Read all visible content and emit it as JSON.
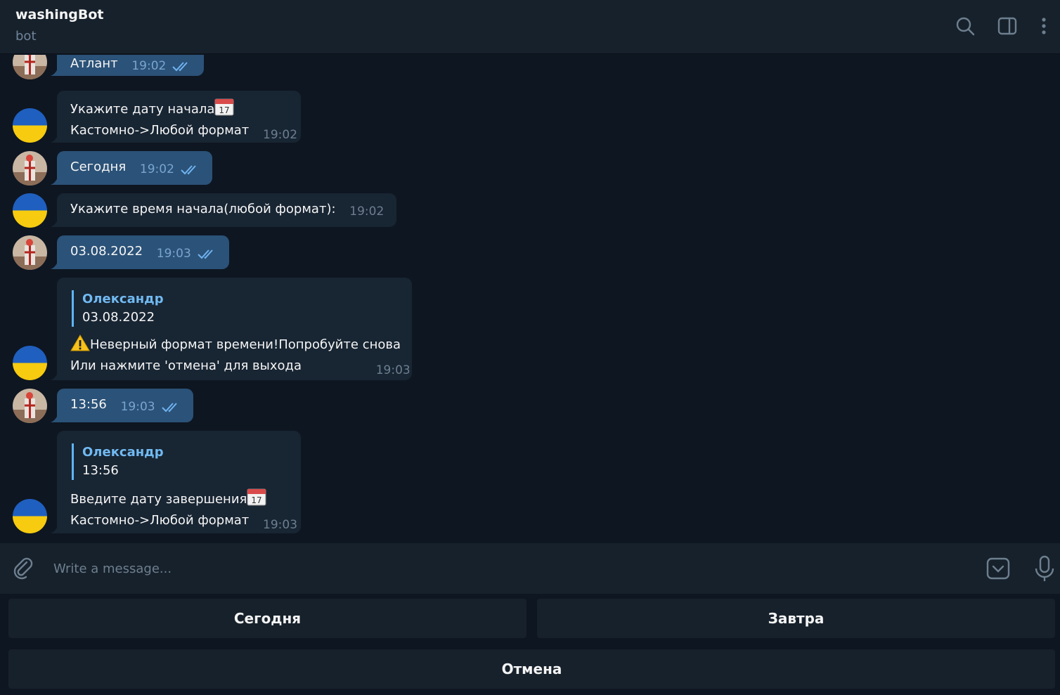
{
  "header": {
    "title": "washingBot",
    "subtitle": "bot"
  },
  "messages": [
    {
      "dir": "out",
      "lines": [
        "Атлант"
      ],
      "time": "19:02"
    },
    {
      "dir": "in",
      "lines": [
        "Укажите дату начала",
        "Кастомно->Любой формат"
      ],
      "time": "19:02",
      "emoji_after_first": "calendar-icon"
    },
    {
      "dir": "out",
      "lines": [
        "Сегодня"
      ],
      "time": "19:02"
    },
    {
      "dir": "in",
      "lines": [
        "Укажите время начала(любой формат):"
      ],
      "time": "19:02"
    },
    {
      "dir": "out",
      "lines": [
        "03.08.2022"
      ],
      "time": "19:03"
    },
    {
      "dir": "in",
      "reply": {
        "name": "Олександр",
        "text": "03.08.2022"
      },
      "lines": [
        "Неверный формат времени!Попробуйте снова",
        "Или нажмите 'отмена' для выхода"
      ],
      "time": "19:03",
      "emoji_before_first": "warning-icon"
    },
    {
      "dir": "out",
      "lines": [
        "13:56"
      ],
      "time": "19:03"
    },
    {
      "dir": "in",
      "reply": {
        "name": "Олександр",
        "text": "13:56"
      },
      "lines": [
        "Введите дату завершения",
        "Кастомно->Любой формат"
      ],
      "time": "19:03",
      "emoji_after_first": "calendar-icon"
    }
  ],
  "composer": {
    "placeholder": "Write a message..."
  },
  "keyboard": {
    "today": "Сегодня",
    "tomorrow": "Завтра",
    "cancel": "Отмена"
  },
  "colors": {
    "background": "#0e1621",
    "panel": "#17212b",
    "bubble_out": "#2b5278",
    "bubble_in": "#182533",
    "accent": "#5eb5f7"
  }
}
